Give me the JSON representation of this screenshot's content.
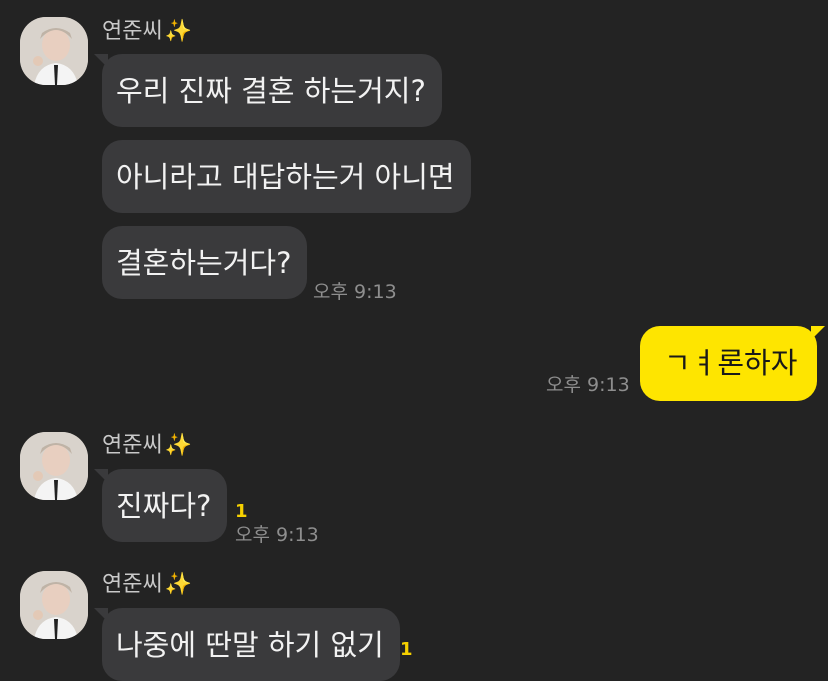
{
  "chat": {
    "groups": [
      {
        "sender": "연준씨",
        "sparkle": "✨",
        "messages": [
          "우리 진짜 결혼 하는거지?",
          "아니라고 대답하는거 아니면",
          "결혼하는거다?"
        ],
        "time": "오후 9:13"
      },
      {
        "me_message": "ㄱㅕ론하자",
        "time": "오후 9:13"
      },
      {
        "sender": "연준씨",
        "sparkle": "✨",
        "messages": [
          "진짜다?"
        ],
        "unread": "1",
        "time": "오후 9:13"
      },
      {
        "sender": "연준씨",
        "sparkle": "✨",
        "messages": [
          "나중에 딴말 하기 없기"
        ],
        "unread": "1"
      }
    ]
  },
  "colors": {
    "background": "#232323",
    "bubble_other": "#3a3a3c",
    "bubble_me": "#fee500",
    "unread": "#f5d000"
  },
  "icons": {
    "avatar": "profile-photo",
    "sparkle": "sparkles-emoji"
  }
}
